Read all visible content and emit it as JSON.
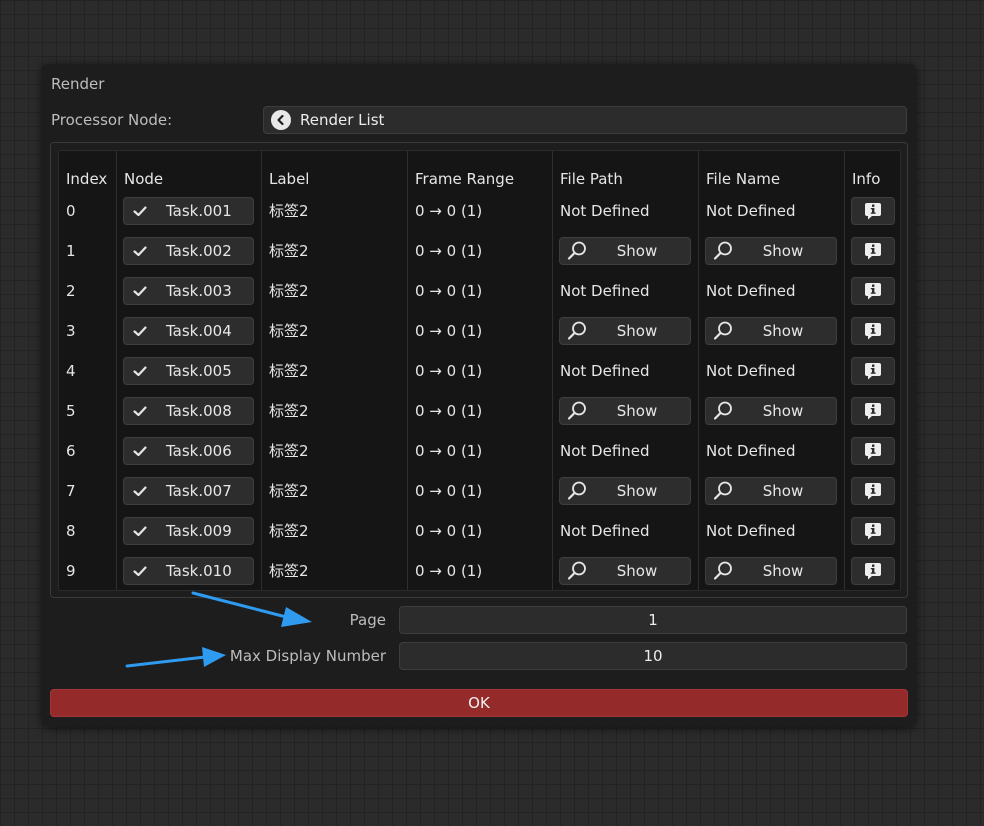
{
  "dialog": {
    "title": "Render",
    "processor_label": "Processor Node:",
    "processor_value": "Render List"
  },
  "table": {
    "headers": [
      "Index",
      "Node",
      "Label",
      "Frame Range",
      "File Path",
      "File Name",
      "Info"
    ],
    "rows": [
      {
        "index": "0",
        "node": "Task.001",
        "label": "标签2",
        "frame_range": "0 → 0 (1)",
        "file_path": "Not Defined",
        "file_name": "Not Defined"
      },
      {
        "index": "1",
        "node": "Task.002",
        "label": "标签2",
        "frame_range": "0 → 0 (1)",
        "file_path": "Show",
        "file_name": "Show"
      },
      {
        "index": "2",
        "node": "Task.003",
        "label": "标签2",
        "frame_range": "0 → 0 (1)",
        "file_path": "Not Defined",
        "file_name": "Not Defined"
      },
      {
        "index": "3",
        "node": "Task.004",
        "label": "标签2",
        "frame_range": "0 → 0 (1)",
        "file_path": "Show",
        "file_name": "Show"
      },
      {
        "index": "4",
        "node": "Task.005",
        "label": "标签2",
        "frame_range": "0 → 0 (1)",
        "file_path": "Not Defined",
        "file_name": "Not Defined"
      },
      {
        "index": "5",
        "node": "Task.008",
        "label": "标签2",
        "frame_range": "0 → 0 (1)",
        "file_path": "Show",
        "file_name": "Show"
      },
      {
        "index": "6",
        "node": "Task.006",
        "label": "标签2",
        "frame_range": "0 → 0 (1)",
        "file_path": "Not Defined",
        "file_name": "Not Defined"
      },
      {
        "index": "7",
        "node": "Task.007",
        "label": "标签2",
        "frame_range": "0 → 0 (1)",
        "file_path": "Show",
        "file_name": "Show"
      },
      {
        "index": "8",
        "node": "Task.009",
        "label": "标签2",
        "frame_range": "0 → 0 (1)",
        "file_path": "Not Defined",
        "file_name": "Not Defined"
      },
      {
        "index": "9",
        "node": "Task.010",
        "label": "标签2",
        "frame_range": "0 → 0 (1)",
        "file_path": "Show",
        "file_name": "Show"
      }
    ]
  },
  "pagination": {
    "page_label": "Page",
    "page_value": "1",
    "max_label": "Max Display Number",
    "max_value": "10"
  },
  "ok_label": "OK",
  "colors": {
    "ok_button": "#952a2a",
    "annotation_arrow": "#2e9bf0"
  },
  "icons": [
    "back-arrow-icon",
    "checkmark-icon",
    "magnifier-icon",
    "info-icon"
  ]
}
